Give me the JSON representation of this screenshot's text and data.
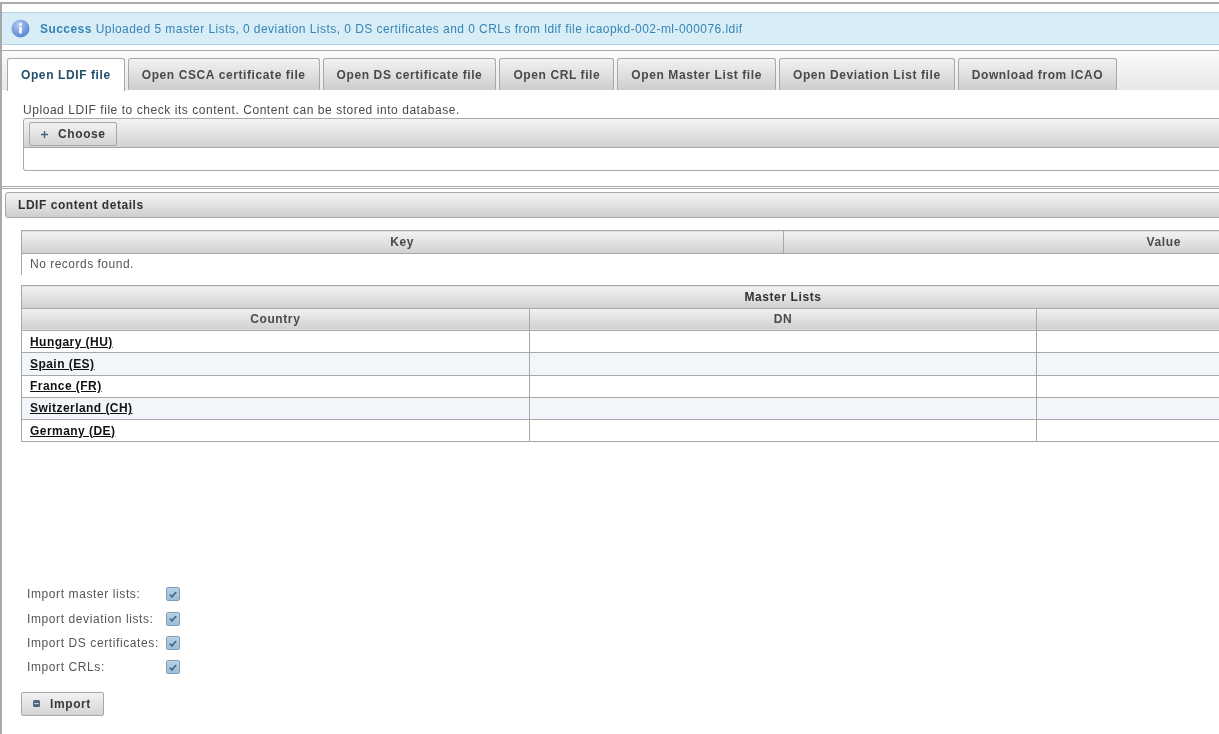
{
  "message": {
    "kind": "info",
    "summary": "Success",
    "detail": "Uploaded 5 master Lists, 0 deviation Lists, 0 DS certificates and 0 CRLs from ldif file icaopkd-002-ml-000076.ldif"
  },
  "tabs": [
    {
      "label": "Open LDIF file",
      "selected": true
    },
    {
      "label": "Open CSCA certificate file",
      "selected": false
    },
    {
      "label": "Open DS certificate file",
      "selected": false
    },
    {
      "label": "Open CRL file",
      "selected": false
    },
    {
      "label": "Open Master List file",
      "selected": false
    },
    {
      "label": "Open Deviation List file",
      "selected": false
    },
    {
      "label": "Download from ICAO",
      "selected": false
    }
  ],
  "upload_panel": {
    "description": "Upload LDIF file to check its content. Content can be stored into database.",
    "choose_button": "Choose"
  },
  "content_panel": {
    "title": "LDIF content details",
    "details_table": {
      "columns": [
        "Key",
        "Value"
      ],
      "empty_message": "No records found."
    },
    "master_lists_table": {
      "title": "Master Lists",
      "columns": [
        "Country",
        "DN"
      ],
      "rows": [
        {
          "country": "Hungary (HU)"
        },
        {
          "country": "Spain (ES)"
        },
        {
          "country": "France (FR)"
        },
        {
          "country": "Switzerland (CH)"
        },
        {
          "country": "Germany (DE)"
        }
      ]
    }
  },
  "import_options": [
    {
      "label": "Import master lists:",
      "checked": true
    },
    {
      "label": "Import deviation lists:",
      "checked": true
    },
    {
      "label": "Import DS certificates:",
      "checked": true
    },
    {
      "label": "Import CRLs:",
      "checked": true
    }
  ],
  "import_button": "Import"
}
